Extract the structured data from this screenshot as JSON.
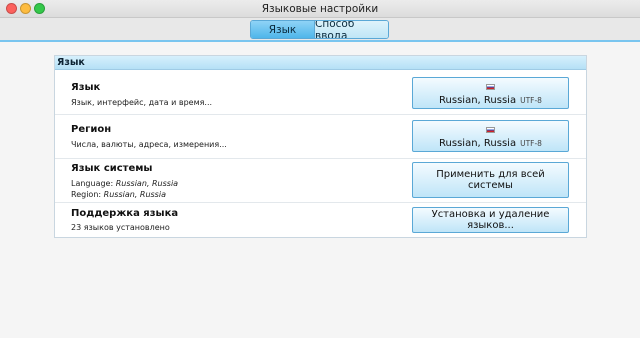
{
  "window": {
    "title": "Языковые настройки"
  },
  "tabs": [
    {
      "label": "Язык"
    },
    {
      "label": "Способ ввода"
    }
  ],
  "panel": {
    "header": "Язык",
    "rows": [
      {
        "title": "Язык",
        "subtitle": "Язык, интерфейс, дата и время...",
        "button": {
          "locale": "Russian, Russia",
          "encoding": "UTF-8",
          "flag": "russia-flag-icon"
        }
      },
      {
        "title": "Регион",
        "subtitle": "Числа, валюты, адреса, измерения...",
        "button": {
          "locale": "Russian, Russia",
          "encoding": "UTF-8",
          "flag": "russia-flag-icon"
        }
      },
      {
        "title": "Язык системы",
        "language_label": "Language:",
        "language_value": "Russian, Russia",
        "region_label": "Region:",
        "region_value": "Russian, Russia",
        "button": {
          "label": "Применить для всей системы"
        }
      },
      {
        "title": "Поддержка языка",
        "subtitle": "23 языков установлено",
        "button": {
          "label": "Установка и удаление языков..."
        }
      }
    ]
  },
  "colors": {
    "accent": "#79c5ef",
    "tab_active": "#4fb6ea",
    "close": "#fc615d",
    "minimize": "#fdbc40",
    "maximize": "#34c84a"
  }
}
